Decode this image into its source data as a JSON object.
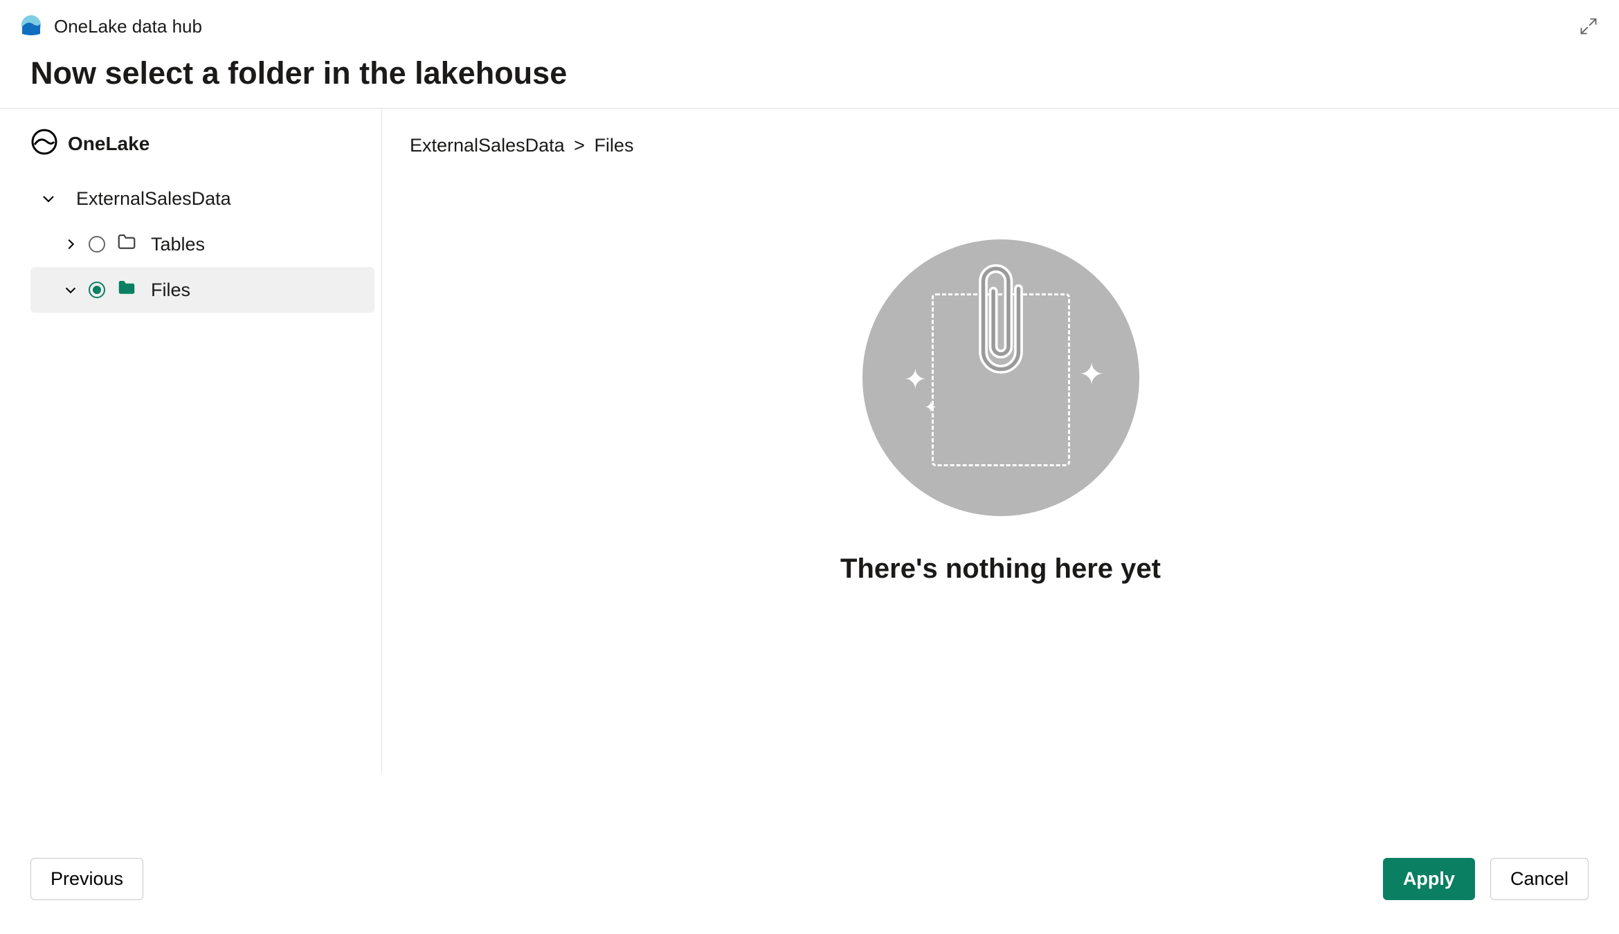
{
  "header": {
    "hub_title": "OneLake data hub"
  },
  "page": {
    "heading": "Now select a folder in the lakehouse"
  },
  "tree": {
    "root_label": "OneLake",
    "lakehouse_label": "ExternalSalesData",
    "nodes": {
      "tables": {
        "label": "Tables",
        "selected": false
      },
      "files": {
        "label": "Files",
        "selected": true
      }
    }
  },
  "breadcrumb": {
    "part1": "ExternalSalesData",
    "sep": ">",
    "part2": "Files"
  },
  "empty_state": {
    "title": "There's nothing here yet"
  },
  "footer": {
    "previous_label": "Previous",
    "apply_label": "Apply",
    "cancel_label": "Cancel"
  },
  "icons": {
    "hub": "onelake-hub-icon",
    "expand": "expand-icon",
    "onelake_root": "onelake-root-icon",
    "chevron_down": "chevron-down-icon",
    "chevron_right": "chevron-right-icon",
    "folder_outline": "folder-outline-icon",
    "folder_filled": "folder-filled-icon",
    "paperclip": "paperclip-icon"
  }
}
